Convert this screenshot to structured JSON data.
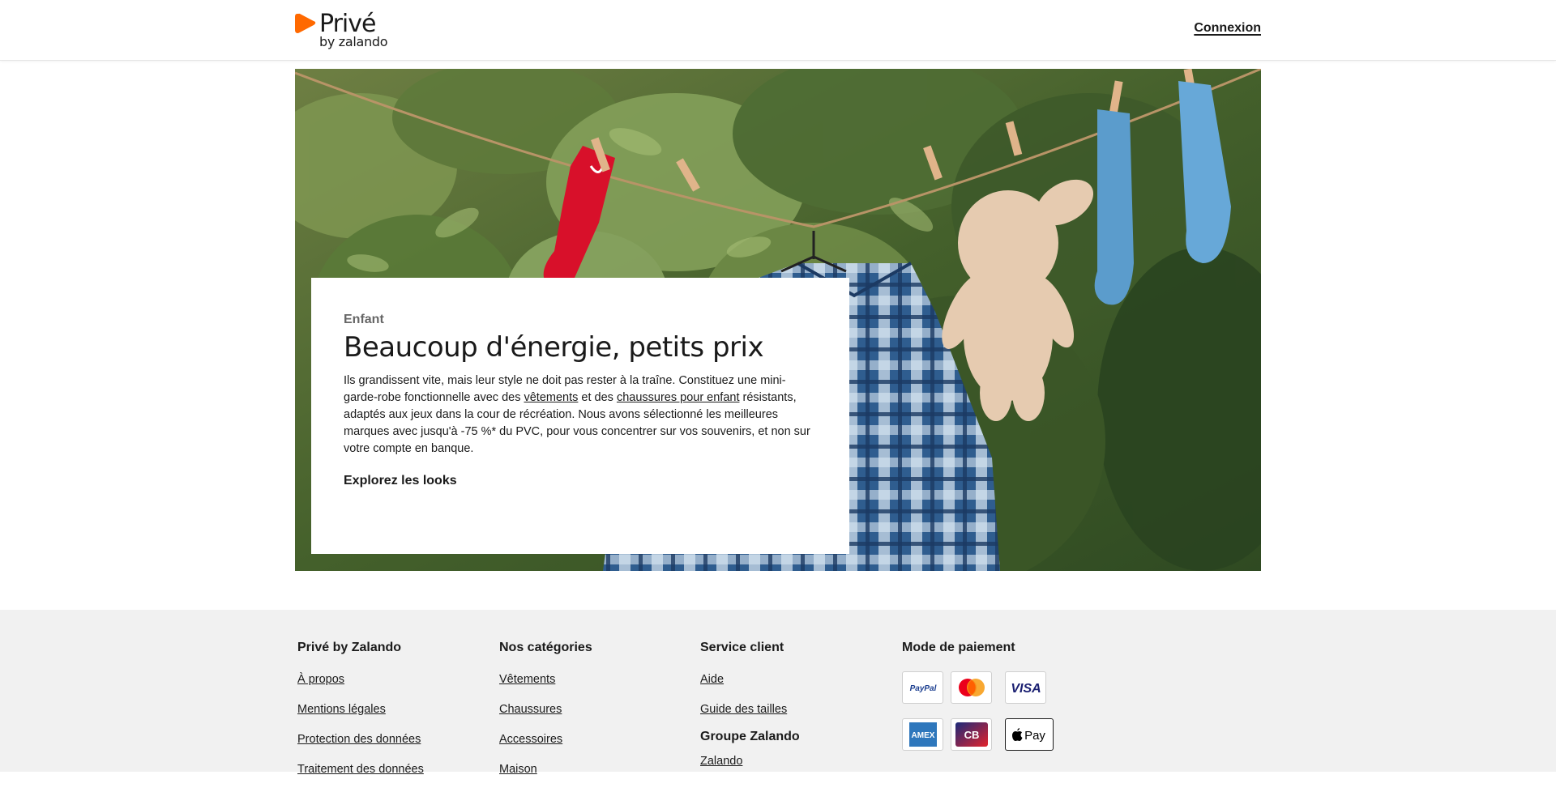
{
  "header": {
    "logo_word": "Privé",
    "logo_sub": "by zalando",
    "login_label": "Connexion"
  },
  "hero": {
    "eyebrow": "Enfant",
    "title": "Beaucoup d'énergie, petits prix",
    "text_parts": {
      "p1": "Ils grandissent vite, mais leur style ne doit pas rester à la traîne. Constituez une mini-garde-robe fonctionnelle avec des ",
      "link1": "vêtements",
      "p2": " et des ",
      "link2": "chaussures pour enfant",
      "p3": " résistants, adaptés aux jeux dans la cour de récréation. Nous avons sélectionné les meilleures marques avec jusqu'à -75 %* du PVC, pour vous concentrer sur vos souvenirs, et non sur votre compte en banque."
    },
    "cta_label": "Explorez les looks"
  },
  "footer": {
    "col1": {
      "title": "Privé by Zalando",
      "links": [
        "À propos",
        "Mentions légales",
        "Protection des données",
        "Traitement des données"
      ]
    },
    "col2": {
      "title": "Nos catégories",
      "links": [
        "Vêtements",
        "Chaussures",
        "Accessoires",
        "Maison"
      ]
    },
    "col3": {
      "title": "Service client",
      "links": [
        "Aide",
        "Guide des tailles"
      ],
      "title2": "Groupe Zalando",
      "links2": [
        "Zalando"
      ]
    },
    "col4": {
      "title": "Mode de paiement"
    },
    "payments": [
      {
        "name": "PayPal",
        "icon": "paypal-icon"
      },
      {
        "name": "Mastercard",
        "icon": "mastercard-icon"
      },
      {
        "name": "VISA",
        "icon": "visa-icon"
      },
      {
        "name": "AMEX",
        "icon": "amex-icon"
      },
      {
        "name": "CB",
        "icon": "cb-icon"
      },
      {
        "name": "Pay",
        "icon": "apple-pay-icon"
      }
    ]
  },
  "colors": {
    "brand_orange": "#ff6900",
    "footer_bg": "#f1f1f1"
  }
}
